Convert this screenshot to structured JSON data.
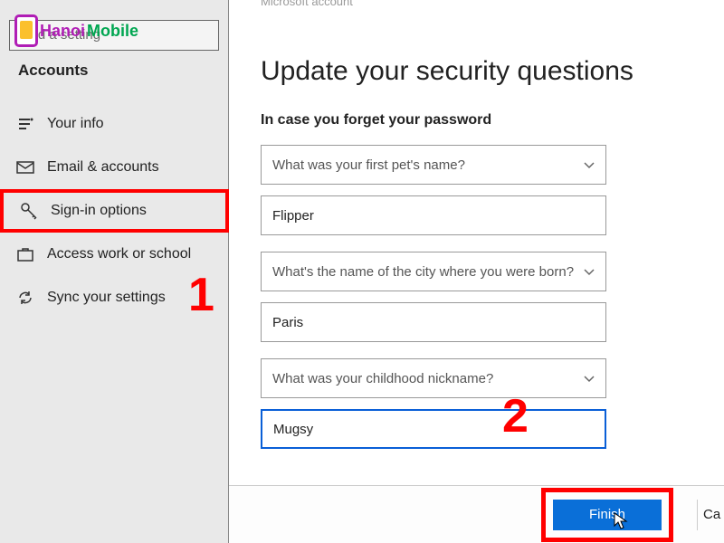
{
  "logo": {
    "text1": "Hanoi",
    "text2": "Mobile"
  },
  "breadcrumb": "Microsoft account",
  "sidebar": {
    "search_placeholder": "Find a setting",
    "section_title": "Accounts",
    "items": [
      {
        "label": "Your info",
        "interactable": true
      },
      {
        "label": "Email & accounts",
        "interactable": true
      },
      {
        "label": "Sign-in options",
        "interactable": true
      },
      {
        "label": "Access work or school",
        "interactable": true
      },
      {
        "label": "Sync your settings",
        "interactable": true
      }
    ]
  },
  "main": {
    "title": "Update your security questions",
    "subhead": "In case you forget your password",
    "q1": "What was your first pet's name?",
    "a1": "Flipper",
    "q2": "What's the name of the city where you were born?",
    "a2": "Paris",
    "q3": "What was your childhood nickname?",
    "a3": "Mugsy",
    "finish_label": "Finish",
    "cancel_cut": "Ca"
  },
  "annotations": {
    "one": "1",
    "two": "2"
  }
}
